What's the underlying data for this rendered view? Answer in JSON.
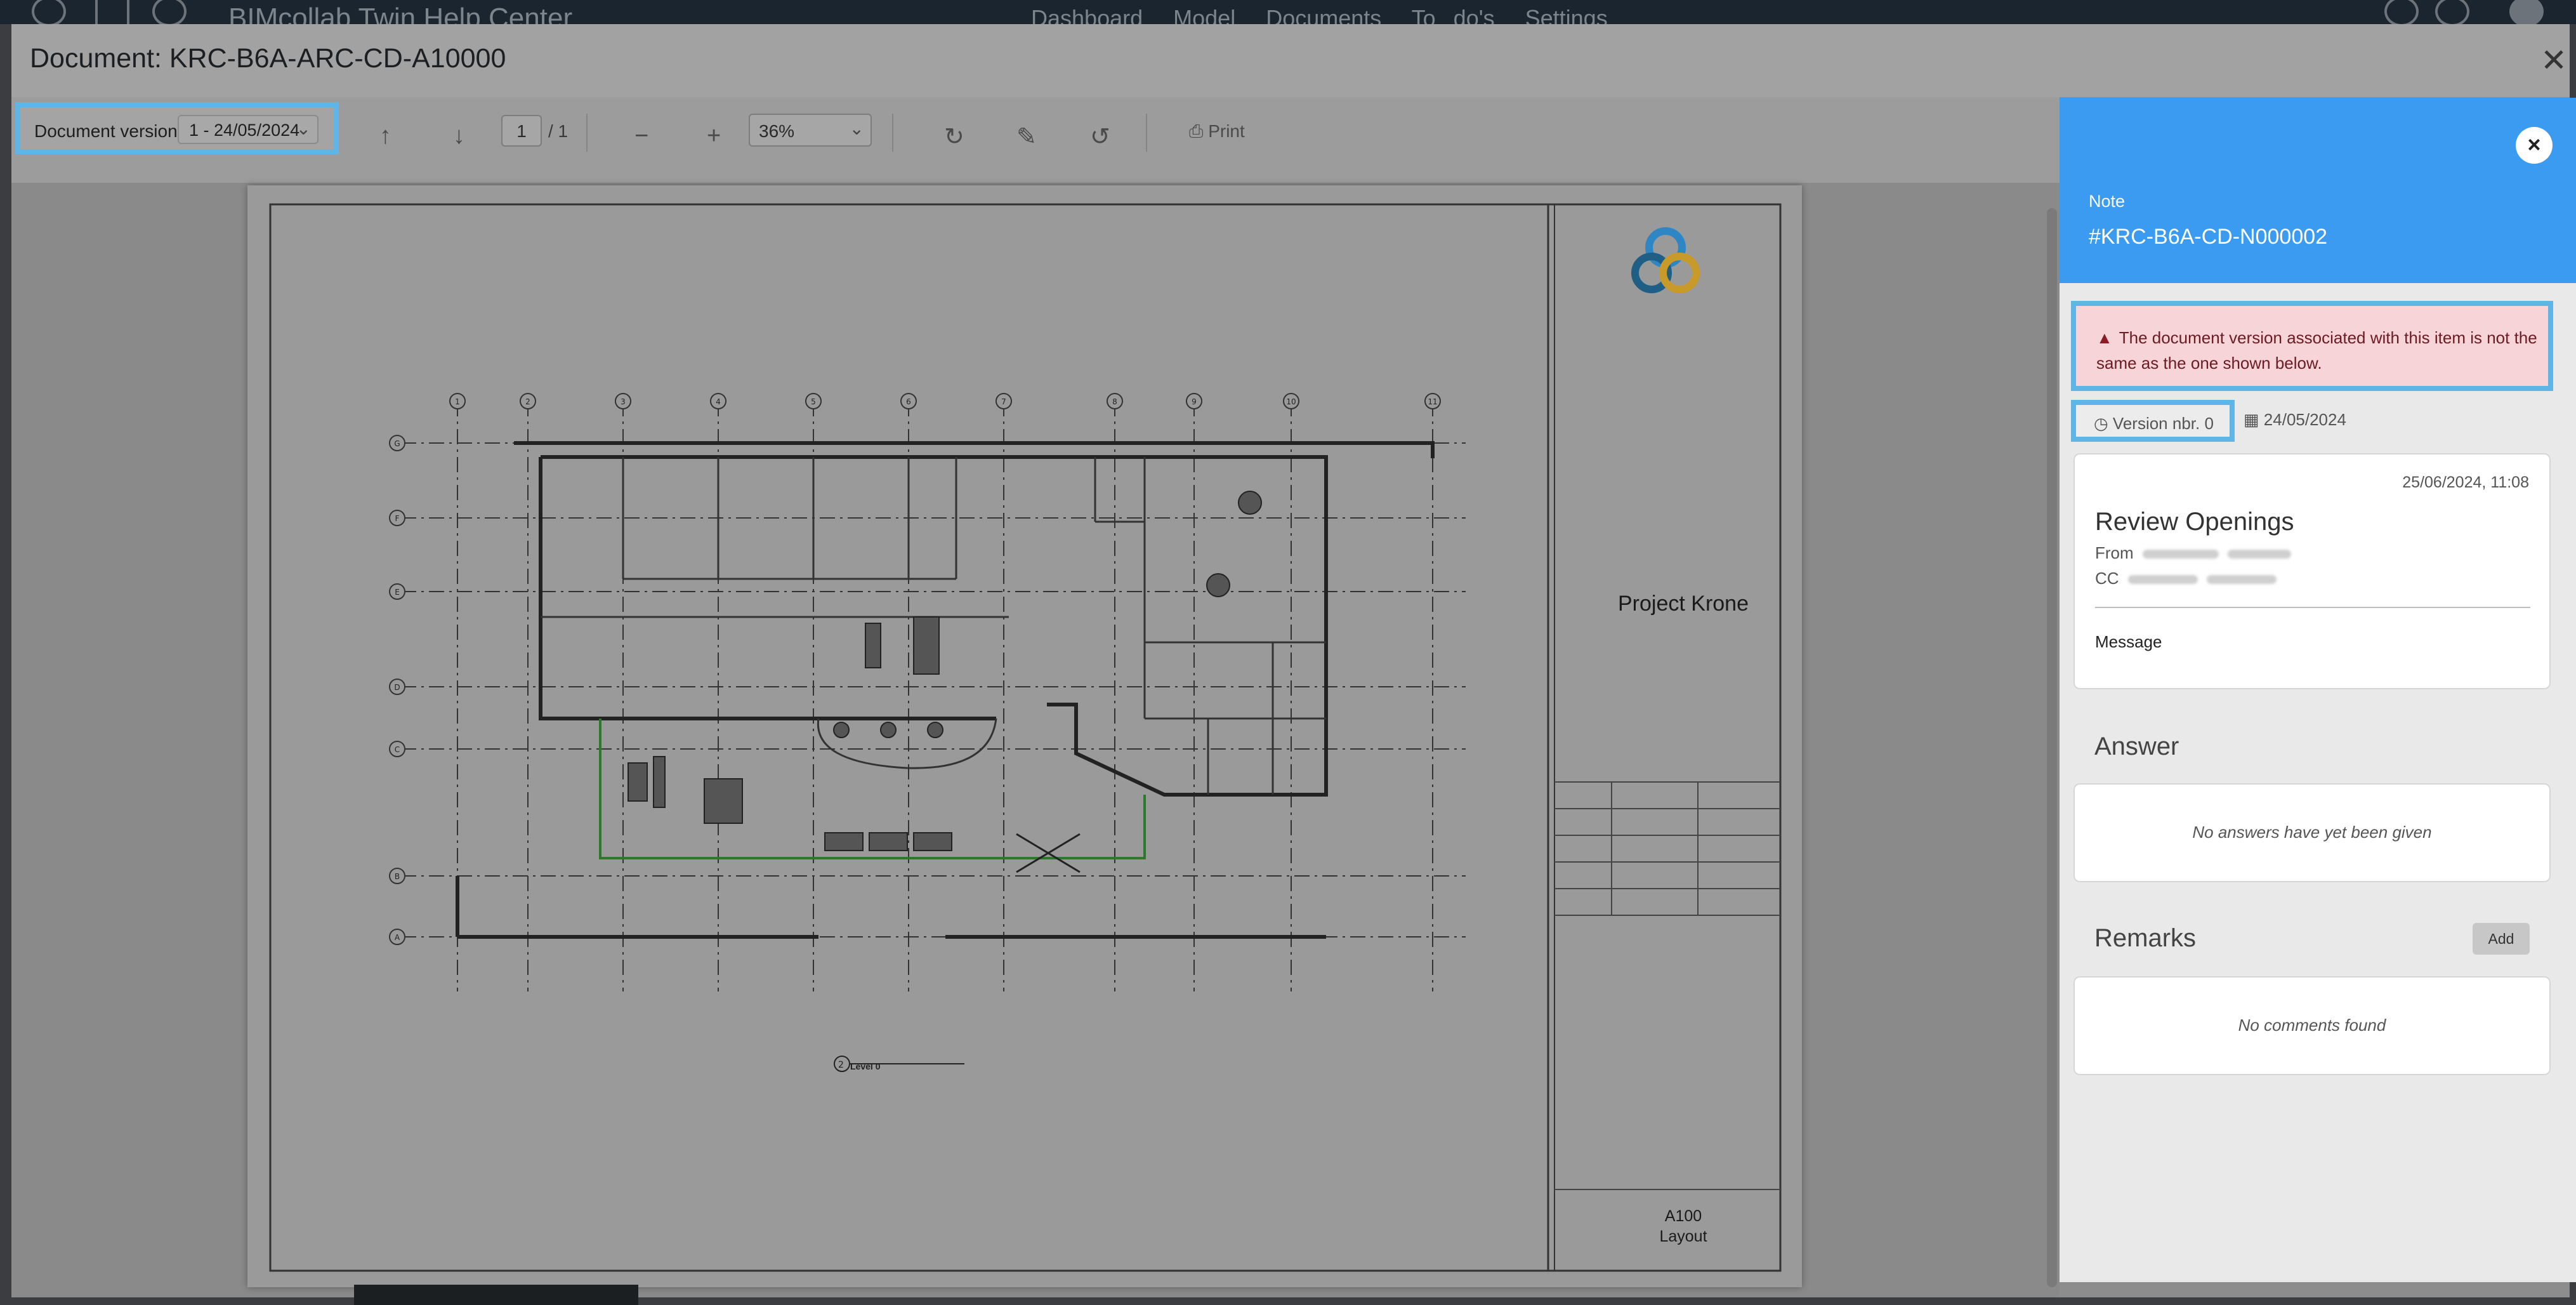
{
  "app": {
    "title": "BIMcollab Twin Help Center",
    "nav": [
      "Dashboard",
      "Model",
      "Documents",
      "To do's",
      "Settings"
    ]
  },
  "modal": {
    "title": "Document: KRC-B6A-ARC-CD-A10000"
  },
  "toolbar": {
    "doc_version_label": "Document version",
    "doc_version_value": "1 - 24/05/2024",
    "page_current": "1",
    "page_total": "/ 1",
    "zoom": "36%",
    "print_label": "Print"
  },
  "drawing": {
    "project_name": "Project Krone",
    "sheet_number": "A100",
    "sheet_name": "Layout",
    "level_label": "Level 0",
    "level_marker": "2",
    "grid_columns": [
      "1",
      "2",
      "3",
      "4",
      "5",
      "6",
      "7",
      "8",
      "9",
      "10",
      "11"
    ],
    "grid_rows": [
      "G",
      "F",
      "E",
      "D",
      "C",
      "B",
      "A"
    ]
  },
  "note": {
    "kind": "Note",
    "id": "#KRC-B6A-CD-N000002",
    "warning": "The document version associated with this item is not the same as the one shown below.",
    "version": "Version nbr. 0",
    "version_date": "24/05/2024",
    "message": {
      "timestamp": "25/06/2024, 11:08",
      "title": "Review Openings",
      "from_label": "From",
      "cc_label": "CC",
      "message_label": "Message"
    },
    "answer_title": "Answer",
    "answer_empty": "No answers have yet been given",
    "remarks_title": "Remarks",
    "add_label": "Add",
    "remarks_empty": "No comments found"
  },
  "colors": {
    "accent": "#3a9bf0",
    "highlight": "#5fb6e6",
    "warning_bg": "#f7d4d8",
    "warning_text": "#6b1b24"
  }
}
